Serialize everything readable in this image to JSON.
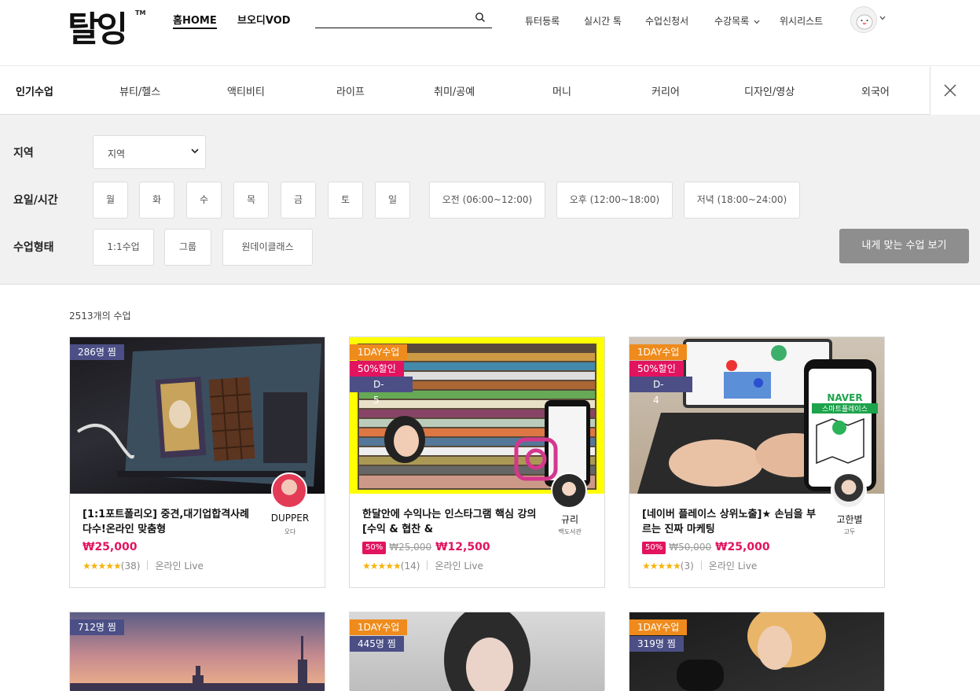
{
  "header": {
    "logo_text": "탈잉",
    "logo_tm": "TM",
    "nav_home": "홈HOME",
    "nav_vod": "브오디VOD",
    "search_placeholder": "",
    "util_links": [
      "튜터등록",
      "실시간 톡",
      "수업신청서",
      "수강목록",
      "위시리스트"
    ]
  },
  "categories": {
    "items": [
      "인기수업",
      "뷰티/헬스",
      "액티비티",
      "라이프",
      "취미/공예",
      "머니",
      "커리어",
      "디자인/영상",
      "외국어"
    ],
    "active": "인기수업"
  },
  "filters": {
    "region_label": "지역",
    "region_value": "지역",
    "time_label": "요일/시간",
    "days": [
      "월",
      "화",
      "수",
      "목",
      "금",
      "토",
      "일"
    ],
    "time_slots": [
      "오전 (06:00~12:00)",
      "오후 (12:00~18:00)",
      "저녁 (18:00~24:00)"
    ],
    "type_label": "수업형태",
    "types": [
      "1:1수업",
      "그룹",
      "원데이클래스"
    ],
    "match_button": "내게 맞는 수업 보기"
  },
  "listing": {
    "count": "2513개의 수업",
    "cards": [
      {
        "tags": [
          "286명 찜"
        ],
        "title": "[1:1포트폴리오] 중견,대기업합격사례 다수!온라인 맞춤형",
        "tutor": "DUPPER",
        "tutor_sub": "오다",
        "price": "₩25,000",
        "discount": "",
        "original": "",
        "stars": "★★★★★",
        "reviews": "(38)",
        "mode": "온라인 Live"
      },
      {
        "tags": [
          "1DAY수업",
          "50%할인",
          "D-5"
        ],
        "title": "한달안에 수익나는 인스타그램 핵심 강의 [수익 & 협찬 &",
        "tutor": "규리",
        "tutor_sub": "백도서관",
        "price": "₩12,500",
        "discount": "50%",
        "original": "₩25,000",
        "stars": "★★★★★",
        "reviews": "(14)",
        "mode": "온라인 Live"
      },
      {
        "tags": [
          "1DAY수업",
          "50%할인",
          "D-4"
        ],
        "title": "[네이버 플레이스 상위노출]★ 손님을 부르는 진짜 마케팅",
        "tutor": "고한별",
        "tutor_sub": "고두",
        "price": "₩25,000",
        "discount": "50%",
        "original": "₩50,000",
        "stars": "★★★★★",
        "reviews": "(3)",
        "mode": "온라인 Live"
      },
      {
        "tags": [
          "712명 찜"
        ]
      },
      {
        "tags": [
          "1DAY수업",
          "445명 찜"
        ]
      },
      {
        "tags": [
          "1DAY수업",
          "319명 찜"
        ]
      }
    ]
  },
  "thumb_text": {
    "naver": "NAVER",
    "smartplace": "스마트플레이스"
  },
  "colors": {
    "accent": "#e2135f",
    "tag_purple": "#4b4f86",
    "tag_orange": "#ef8b1c",
    "button_gray": "#8e8e8e"
  }
}
